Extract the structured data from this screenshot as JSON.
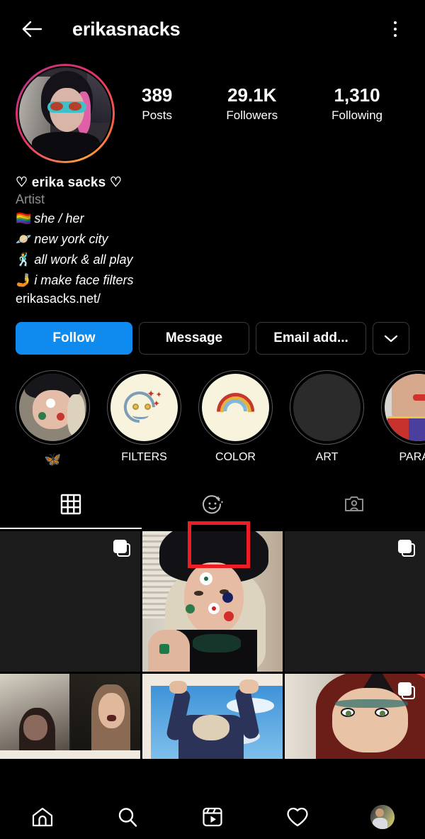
{
  "header": {
    "title": "erikasnacks",
    "back_icon": "back-arrow-icon",
    "menu_icon": "overflow-menu-icon"
  },
  "profile": {
    "avatar_alt": "profile-picture",
    "stats": [
      {
        "value": "389",
        "label": "Posts"
      },
      {
        "value": "29.1K",
        "label": "Followers"
      },
      {
        "value": "1,310",
        "label": "Following"
      }
    ],
    "display_name": "♡ erika sacks ♡",
    "category": "Artist",
    "bio_lines": [
      {
        "emoji": "🏳️‍🌈",
        "text": "she / her"
      },
      {
        "emoji": "🪐",
        "text": "new york city"
      },
      {
        "emoji": "🕺",
        "text": "all work & all play"
      },
      {
        "emoji": "🤳",
        "text": "i make face filters"
      }
    ],
    "website": "erikasacks.net/"
  },
  "actions": {
    "follow": "Follow",
    "message": "Message",
    "email": "Email add...",
    "more_icon": "chevron-down-icon",
    "follow_color": "#0f8bf0"
  },
  "highlights": [
    {
      "label": "🦋",
      "cover": "selfie-flowers",
      "is_emoji": true
    },
    {
      "label": "FILTERS",
      "cover": "smiley-sparkle",
      "is_emoji": false
    },
    {
      "label": "COLOR",
      "cover": "rainbow",
      "is_emoji": false
    },
    {
      "label": "ART",
      "cover": "blank-dark",
      "is_emoji": false
    },
    {
      "label": "PARAD",
      "cover": "parade-outfit",
      "is_emoji": false
    }
  ],
  "tabs": [
    {
      "name": "grid-tab",
      "icon": "grid-icon",
      "active": true
    },
    {
      "name": "effects-tab",
      "icon": "smiley-sparkle-icon",
      "active": false
    },
    {
      "name": "tagged-tab",
      "icon": "tagged-person-icon",
      "active": false
    }
  ],
  "annotation": {
    "color": "#ee1c25",
    "target": "effects-tab"
  },
  "grid": [
    {
      "type": "placeholder",
      "carousel": true
    },
    {
      "type": "photo-beret-flowers",
      "carousel": false
    },
    {
      "type": "placeholder",
      "carousel": true
    },
    {
      "type": "photo-video-call",
      "carousel": false
    },
    {
      "type": "photo-sky-arms",
      "carousel": false
    },
    {
      "type": "photo-red-hair-cat-ears",
      "carousel": true
    }
  ],
  "bottom_nav": [
    {
      "icon": "home-icon",
      "name": "nav-home"
    },
    {
      "icon": "search-icon",
      "name": "nav-search"
    },
    {
      "icon": "reels-icon",
      "name": "nav-reels"
    },
    {
      "icon": "heart-icon",
      "name": "nav-activity"
    },
    {
      "icon": "avatar-icon",
      "name": "nav-profile"
    }
  ]
}
